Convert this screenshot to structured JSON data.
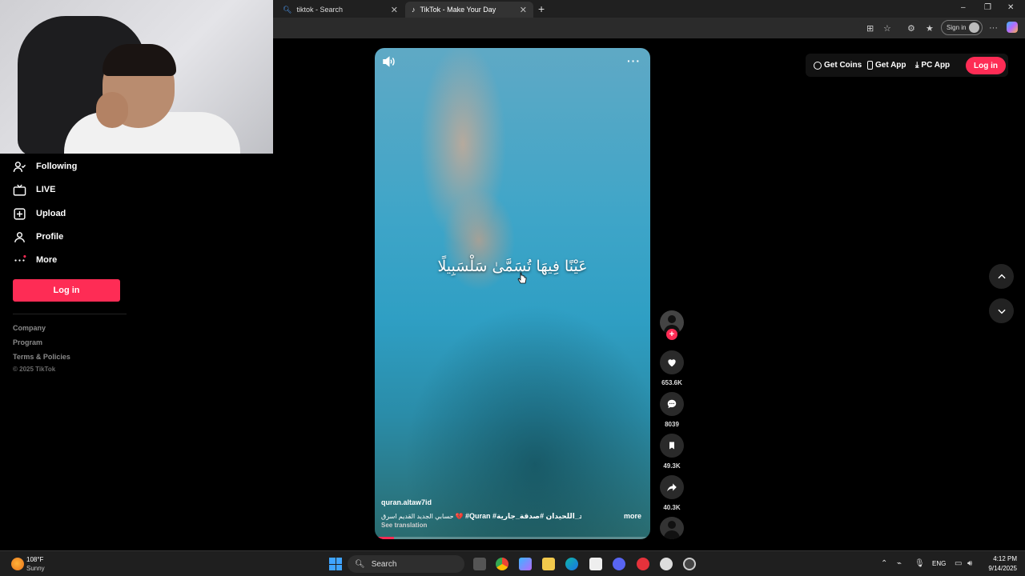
{
  "browser": {
    "tabs": [
      {
        "label": "tiktok - Search",
        "active": false
      },
      {
        "label": "TikTok - Make Your Day",
        "active": true
      }
    ],
    "signin_label": "Sign in"
  },
  "sidebar": {
    "items": [
      {
        "label": "Following",
        "icon": "following-icon"
      },
      {
        "label": "LIVE",
        "icon": "live-icon"
      },
      {
        "label": "Upload",
        "icon": "upload-icon"
      },
      {
        "label": "Profile",
        "icon": "profile-icon"
      },
      {
        "label": "More",
        "icon": "more-icon"
      }
    ],
    "login_label": "Log in",
    "footer_links": [
      "Company",
      "Program",
      "Terms & Policies"
    ],
    "copyright": "© 2025 TikTok"
  },
  "header": {
    "get_coins": "Get Coins",
    "get_app": "Get App",
    "pc_app": "PC App",
    "login": "Log in"
  },
  "video": {
    "caption": "عَيْنًا فِيهَا تُسَمَّىٰ سَلْسَبِيلًا",
    "author": "quran.altaw7id",
    "description_text": "حسابي الجديد القديم اسرق 💔",
    "description_tags": "#Quran #محمد_اللحيدان #صدقة_جارية ...",
    "see_more": "more",
    "see_translation": "See translation",
    "progress": 0.07
  },
  "actions": {
    "likes": "653.6K",
    "comments": "8039",
    "saves": "49.3K",
    "shares": "40.3K"
  },
  "taskbar": {
    "weather_temp": "108°F",
    "weather_desc": "Sunny",
    "search_placeholder": "Search",
    "language": "ENG",
    "time": "4:12 PM",
    "date": "9/14/2025"
  },
  "colors": {
    "brand": "#fe2c55",
    "background": "#000000"
  }
}
